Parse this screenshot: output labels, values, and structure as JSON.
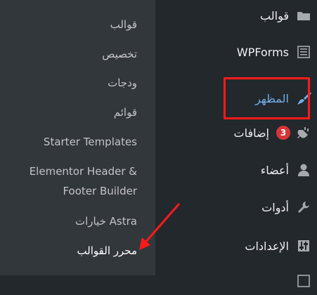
{
  "submenu": {
    "items": [
      {
        "label": "قوالب"
      },
      {
        "label": "تخصيص"
      },
      {
        "label": "ودجات"
      },
      {
        "label": "قوائم"
      },
      {
        "label": "Starter Templates"
      },
      {
        "label_line1": "Elementor Header &",
        "label_line2": "Footer Builder"
      },
      {
        "label": "خيارات Astra"
      },
      {
        "label": "محرر القوالب"
      }
    ]
  },
  "menu": {
    "items": [
      {
        "label": "قوالب",
        "icon": "folder-icon"
      },
      {
        "label": "WPForms",
        "icon": "wpforms-icon"
      },
      {
        "label": "المظهر",
        "icon": "paintbrush-icon",
        "current": true
      },
      {
        "label": "إضافات",
        "icon": "plugin-icon",
        "badge": "3"
      },
      {
        "label": "أعضاء",
        "icon": "user-icon"
      },
      {
        "label": "أدوات",
        "icon": "wrench-icon"
      },
      {
        "label": "الإعدادات",
        "icon": "settings-icon"
      }
    ]
  },
  "colors": {
    "menu_bg": "#23282d",
    "submenu_bg": "#32373c",
    "current": "#72aee6",
    "badge": "#d63638",
    "annotation": "#ff1a1a"
  }
}
